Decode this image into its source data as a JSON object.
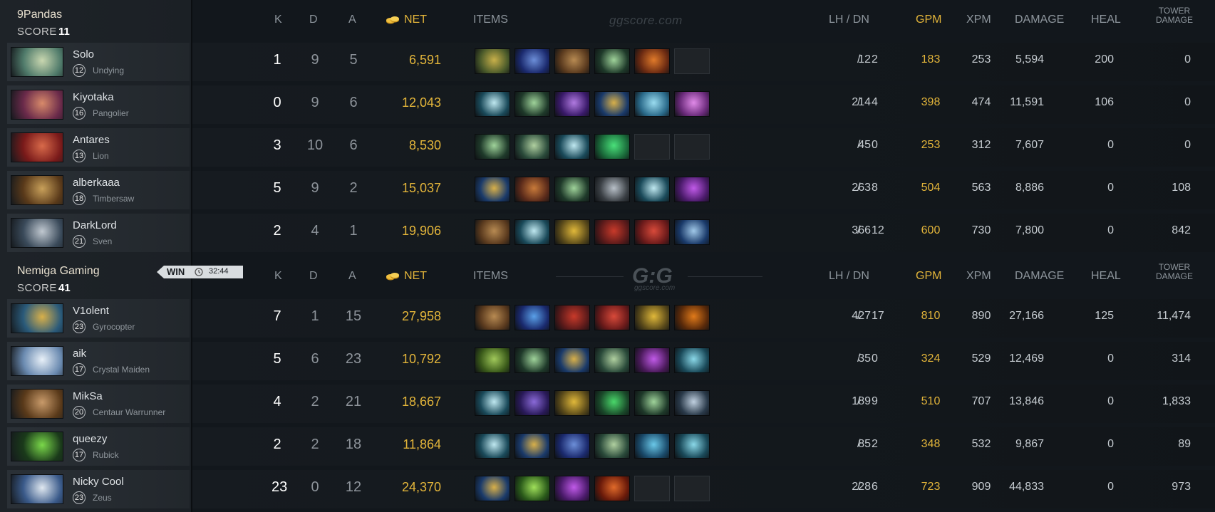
{
  "header": {
    "k": "K",
    "d": "D",
    "a": "A",
    "net": "NET",
    "items": "ITEMS",
    "lh_dn": "LH  /  DN",
    "gpm": "GPM",
    "xpm": "XPM",
    "damage": "DAMAGE",
    "heal": "HEAL",
    "tower_damage": "TOWER DAMAGE",
    "watermark": "ggscore.com",
    "logo": "G:G",
    "logo_sub": "ggscore.com"
  },
  "colors": {
    "gold": "#e3b53a",
    "background": "#12171c",
    "panel": "#1e2328"
  },
  "result": {
    "label": "WIN",
    "time": "32:44"
  },
  "teams": [
    {
      "name": "9Pandas",
      "score_label": "SCORE",
      "score": "11",
      "players": [
        {
          "name": "Solo",
          "level": "12",
          "hero": "Undying",
          "k": "1",
          "d": "9",
          "a": "5",
          "net": "6,591",
          "lh": "12",
          "dn": "2",
          "gpm": "183",
          "xpm": "253",
          "damage": "5,594",
          "heal": "200",
          "tower": "0",
          "portrait": [
            "#4f7a6a",
            "#c9d7b0"
          ],
          "items": [
            [
              "#4a5a2a",
              "#c8b04a"
            ],
            [
              "#1b2a6e",
              "#6c8ed8"
            ],
            [
              "#5a3a1e",
              "#b78a52"
            ],
            [
              "#1f3a2a",
              "#9fd39a"
            ],
            [
              "#6a2a12",
              "#e07a2a"
            ],
            null
          ]
        },
        {
          "name": "Kiyotaka",
          "level": "16",
          "hero": "Pangolier",
          "k": "0",
          "d": "9",
          "a": "6",
          "net": "12,043",
          "lh": "214",
          "dn": "4",
          "gpm": "398",
          "xpm": "474",
          "damage": "11,591",
          "heal": "106",
          "tower": "0",
          "portrait": [
            "#6a2a4a",
            "#d88a6a"
          ],
          "items": [
            [
              "#1a4a5a",
              "#bfe8f0"
            ],
            [
              "#1f3a2a",
              "#9fd39a"
            ],
            [
              "#3a1a6a",
              "#b07ae0"
            ],
            [
              "#1a3a6a",
              "#d8b04a"
            ],
            [
              "#2a6a8a",
              "#9adcf0"
            ],
            [
              "#6a2a7a",
              "#e08ae8"
            ]
          ]
        },
        {
          "name": "Antares",
          "level": "13",
          "hero": "Lion",
          "k": "3",
          "d": "10",
          "a": "6",
          "net": "8,530",
          "lh": "45",
          "dn": "0",
          "gpm": "253",
          "xpm": "312",
          "damage": "7,607",
          "heal": "0",
          "tower": "0",
          "portrait": [
            "#7a1a1a",
            "#d86a4a"
          ],
          "items": [
            [
              "#1f3a2a",
              "#9fd39a"
            ],
            [
              "#2a4a3a",
              "#b0d0a0"
            ],
            [
              "#1a4a5a",
              "#bfe8f0"
            ],
            [
              "#1a6a3a",
              "#4ae07a"
            ],
            null,
            null
          ]
        },
        {
          "name": "alberkaaa",
          "level": "18",
          "hero": "Timbersaw",
          "k": "5",
          "d": "9",
          "a": "2",
          "net": "15,037",
          "lh": "263",
          "dn": "8",
          "gpm": "504",
          "xpm": "563",
          "damage": "8,886",
          "heal": "0",
          "tower": "108",
          "portrait": [
            "#5a3a1a",
            "#c8a05a"
          ],
          "items": [
            [
              "#1a3a6a",
              "#d8b04a"
            ],
            [
              "#5a2a1a",
              "#c87a3a"
            ],
            [
              "#1f3a2a",
              "#9fd39a"
            ],
            [
              "#3a3f44",
              "#b8c0c8"
            ],
            [
              "#1a4a5a",
              "#bfe8f0"
            ],
            [
              "#4a1a6a",
              "#c05ae8"
            ]
          ]
        },
        {
          "name": "DarkLord",
          "level": "21",
          "hero": "Sven",
          "k": "2",
          "d": "4",
          "a": "1",
          "net": "19,906",
          "lh": "366",
          "dn": "12",
          "gpm": "600",
          "xpm": "730",
          "damage": "7,800",
          "heal": "0",
          "tower": "842",
          "portrait": [
            "#3a4a5a",
            "#c0c8d0"
          ],
          "items": [
            [
              "#5a3a1e",
              "#b78a52"
            ],
            [
              "#1a4a5a",
              "#bfe8f0"
            ],
            [
              "#5a4a1a",
              "#e0b83a"
            ],
            [
              "#5a1a1a",
              "#c83a2a"
            ],
            [
              "#6a1a1a",
              "#d84a3a"
            ],
            [
              "#1a3a6a",
              "#a0c8e8"
            ]
          ]
        }
      ]
    },
    {
      "name": "Nemiga Gaming",
      "score_label": "SCORE",
      "score": "41",
      "players": [
        {
          "name": "V1olent",
          "level": "23",
          "hero": "Gyrocopter",
          "k": "7",
          "d": "1",
          "a": "15",
          "net": "27,958",
          "lh": "427",
          "dn": "17",
          "gpm": "810",
          "xpm": "890",
          "damage": "27,166",
          "heal": "125",
          "tower": "11,474",
          "portrait": [
            "#2a5a7a",
            "#d8b04a"
          ],
          "items": [
            [
              "#5a3a1e",
              "#b78a52"
            ],
            [
              "#1a2a6e",
              "#5aa0e8"
            ],
            [
              "#5a1a1a",
              "#c83a2a"
            ],
            [
              "#6a1a1a",
              "#d84a3a"
            ],
            [
              "#5a4a1a",
              "#e0b83a"
            ],
            [
              "#5a2a0a",
              "#e07a1a"
            ]
          ]
        },
        {
          "name": "aik",
          "level": "17",
          "hero": "Crystal Maiden",
          "k": "5",
          "d": "6",
          "a": "23",
          "net": "10,792",
          "lh": "35",
          "dn": "0",
          "gpm": "324",
          "xpm": "529",
          "damage": "12,469",
          "heal": "0",
          "tower": "314",
          "portrait": [
            "#6a8ab0",
            "#e8f0f8"
          ],
          "items": [
            [
              "#3a5a1a",
              "#a0c85a"
            ],
            [
              "#1f3a2a",
              "#9fd39a"
            ],
            [
              "#1a3a6a",
              "#d8b04a"
            ],
            [
              "#2a4a3a",
              "#b0d0a0"
            ],
            [
              "#4a1a5a",
              "#c05ae8"
            ],
            [
              "#1a4a5a",
              "#8ad8e8"
            ]
          ]
        },
        {
          "name": "MikSa",
          "level": "20",
          "hero": "Centaur Warrunner",
          "k": "4",
          "d": "2",
          "a": "21",
          "net": "18,667",
          "lh": "189",
          "dn": "9",
          "gpm": "510",
          "xpm": "707",
          "damage": "13,846",
          "heal": "0",
          "tower": "1,833",
          "portrait": [
            "#5a3a1a",
            "#c89a6a"
          ],
          "items": [
            [
              "#1a4a5a",
              "#bfe8f0"
            ],
            [
              "#2a1a5a",
              "#8a6ad8"
            ],
            [
              "#5a4a1a",
              "#e0b83a"
            ],
            [
              "#1a4a2a",
              "#4ad86a"
            ],
            [
              "#1f3a2a",
              "#9fd39a"
            ],
            [
              "#2a3a4a",
              "#c0d0e0"
            ]
          ]
        },
        {
          "name": "queezy",
          "level": "17",
          "hero": "Rubick",
          "k": "2",
          "d": "2",
          "a": "18",
          "net": "11,864",
          "lh": "85",
          "dn": "2",
          "gpm": "348",
          "xpm": "532",
          "damage": "9,867",
          "heal": "0",
          "tower": "89",
          "portrait": [
            "#1a3a1a",
            "#7ad84a"
          ],
          "items": [
            [
              "#1a4a5a",
              "#bfe8f0"
            ],
            [
              "#1a3a6a",
              "#d8b04a"
            ],
            [
              "#1b2a6e",
              "#6c8ed8"
            ],
            [
              "#2a4a3a",
              "#b0d0a0"
            ],
            [
              "#1a4a6a",
              "#6ac8e8"
            ],
            [
              "#1a4a5a",
              "#8ad8e8"
            ]
          ]
        },
        {
          "name": "Nicky Cool",
          "level": "23",
          "hero": "Zeus",
          "k": "23",
          "d": "0",
          "a": "12",
          "net": "24,370",
          "lh": "228",
          "dn": "6",
          "gpm": "723",
          "xpm": "909",
          "damage": "44,833",
          "heal": "0",
          "tower": "973",
          "portrait": [
            "#3a5a8a",
            "#e0e8f0"
          ],
          "items": [
            [
              "#1a3a6a",
              "#d8b04a"
            ],
            [
              "#2a5a1a",
              "#a0e05a"
            ],
            [
              "#4a1a6a",
              "#c05ae8"
            ],
            [
              "#6a1a0a",
              "#e06a2a"
            ],
            null,
            null
          ]
        }
      ]
    }
  ]
}
